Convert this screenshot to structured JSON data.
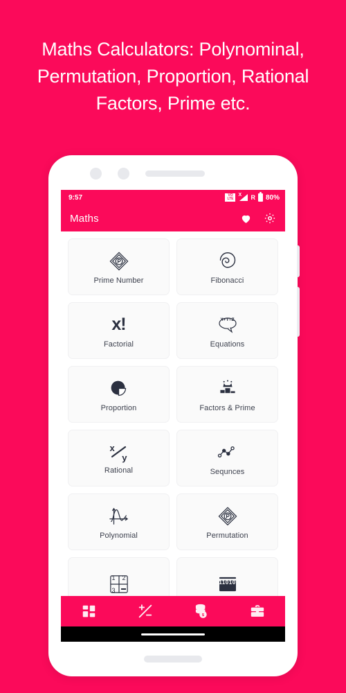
{
  "promo": {
    "headline": "Maths Calculators: Polynominal, Permutation, Proportion, Rational Factors, Prime etc.",
    "background_color": "#fb0a5a",
    "text_color": "#ffffff"
  },
  "statusbar": {
    "time": "9:57",
    "volte_line1": "VO",
    "volte_line2": "LTE",
    "signal_x": "X",
    "roaming": "R",
    "battery_percent": "80%"
  },
  "appbar": {
    "title": "Maths",
    "favorite_icon": "heart-icon",
    "settings_icon": "gear-icon",
    "background_color": "#fb0a5a"
  },
  "grid": {
    "items": [
      {
        "label": "Prime Number",
        "icon": "diamond-p-icon"
      },
      {
        "label": "Fibonacci",
        "icon": "spiral-icon"
      },
      {
        "label": "Factorial",
        "icon": "x-factorial-icon"
      },
      {
        "label": "Equations",
        "icon": "speech-bubble-equation-icon"
      },
      {
        "label": "Proportion",
        "icon": "pie-chart-icon"
      },
      {
        "label": "Factors & Prime",
        "icon": "podium-crown-icon"
      },
      {
        "label": "Rational",
        "icon": "x-over-y-icon"
      },
      {
        "label": "Sequnces",
        "icon": "connected-nodes-icon"
      },
      {
        "label": "Polynomial",
        "icon": "graph-curve-icon"
      },
      {
        "label": "Permutation",
        "icon": "diamond-p-icon"
      },
      {
        "label": "",
        "icon": "matrix-grid-icon"
      },
      {
        "label": "",
        "icon": "binary-icon"
      }
    ],
    "equation_text": "X+Y=Z",
    "factorial_text": "x!",
    "rational_numerator": "x",
    "rational_denominator": "y",
    "matrix_cells": [
      "1",
      "2",
      "3",
      ""
    ],
    "binary_text": "11010"
  },
  "bottomnav": {
    "items": [
      {
        "icon": "grid-dashboard-icon"
      },
      {
        "icon": "plus-minus-icon"
      },
      {
        "icon": "coins-dollar-icon"
      },
      {
        "icon": "briefcase-icon"
      }
    ]
  }
}
